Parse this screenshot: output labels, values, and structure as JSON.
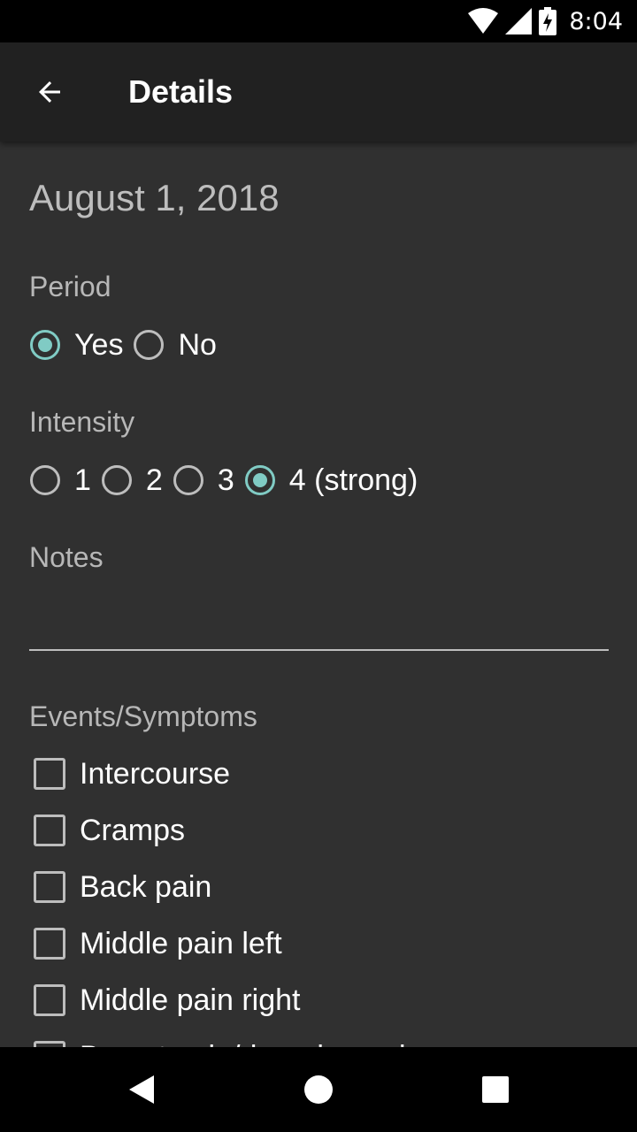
{
  "status_bar": {
    "time": "8:04",
    "icons": [
      "wifi-icon",
      "cell-signal-icon",
      "battery-charging-icon"
    ]
  },
  "app_bar": {
    "title": "Details",
    "back_icon": "arrow-back-icon"
  },
  "date": "August 1, 2018",
  "period": {
    "label": "Period",
    "options": [
      {
        "label": "Yes",
        "checked": true
      },
      {
        "label": "No",
        "checked": false
      }
    ]
  },
  "intensity": {
    "label": "Intensity",
    "options": [
      {
        "label": "1",
        "checked": false
      },
      {
        "label": "2",
        "checked": false
      },
      {
        "label": "3",
        "checked": false
      },
      {
        "label": "4 (strong)",
        "checked": true
      }
    ]
  },
  "notes": {
    "label": "Notes",
    "value": ""
  },
  "events": {
    "label": "Events/Symptoms",
    "items": [
      {
        "label": "Intercourse",
        "checked": false
      },
      {
        "label": "Cramps",
        "checked": false
      },
      {
        "label": "Back pain",
        "checked": false
      },
      {
        "label": "Middle pain left",
        "checked": false
      },
      {
        "label": "Middle pain right",
        "checked": false
      },
      {
        "label": "Breast pain/dropping pain",
        "checked": false
      }
    ]
  },
  "nav_bar": {
    "icons": [
      "back-triangle-icon",
      "home-circle-icon",
      "recents-square-icon"
    ]
  },
  "colors": {
    "accent": "#80cbc4",
    "background": "#303030",
    "app_bar": "#212121"
  }
}
